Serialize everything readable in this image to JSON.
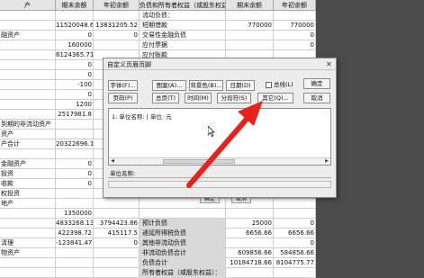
{
  "sheet": {
    "headers": [
      "产",
      "期末余额",
      "年初余额",
      "负债和所有者权益（或股东权益）",
      "期末余额",
      "年初余额"
    ],
    "rows": [
      {
        "label": "",
        "v1": "",
        "v2": "",
        "label2": "流动负债：",
        "v3": "",
        "v4": ""
      },
      {
        "label": "",
        "v1": "11520048.62",
        "v2": "13831205.52",
        "label2": "短期借款",
        "v3": "770000",
        "v4": "770000"
      },
      {
        "label": "融资产",
        "v1": "0",
        "v2": "0",
        "label2": "交易性金融负债",
        "v3": "",
        "v4": "0"
      },
      {
        "label": "",
        "v1": "160000",
        "v2": "",
        "label2": "应付票据",
        "v3": "",
        "v4": "0"
      },
      {
        "label": "",
        "v1": "6124365.71",
        "v2": "",
        "label2": "应付账款",
        "v3": "",
        "v4": ""
      },
      {
        "label": "",
        "v1": "0",
        "v2": "",
        "label2": "",
        "v3": "",
        "v4": ""
      },
      {
        "label": "",
        "v1": "0",
        "v2": "",
        "label2": "",
        "v3": "",
        "v4": ""
      },
      {
        "label": "",
        "v1": "-100",
        "v2": "",
        "label2": "",
        "v3": "",
        "v4": ""
      },
      {
        "label": "",
        "v1": "0",
        "v2": "",
        "label2": "",
        "v3": "",
        "v4": ""
      },
      {
        "label": "",
        "v1": "1200",
        "v2": "",
        "label2": "",
        "v3": "",
        "v4": ""
      },
      {
        "label": "",
        "v1": "2517981.8",
        "v2": "",
        "label2": "",
        "v3": "",
        "v4": ""
      },
      {
        "label": "到期的非流动资产",
        "v1": "",
        "v2": "",
        "label2": "",
        "v3": "",
        "v4": ""
      },
      {
        "label": "资产",
        "v1": "",
        "v2": "",
        "label2": "",
        "v3": "",
        "v4": ""
      },
      {
        "label": "产合计",
        "v1": "20322696.12",
        "v2": "",
        "label2": "",
        "v3": "",
        "v4": ""
      },
      {
        "label": "",
        "v1": "",
        "v2": "",
        "label2": "",
        "v3": "",
        "v4": ""
      },
      {
        "label": "金融资产",
        "v1": "0",
        "v2": "",
        "label2": "",
        "v3": "",
        "v4": ""
      },
      {
        "label": "投资",
        "v1": "0",
        "v2": "",
        "label2": "",
        "v3": "",
        "v4": ""
      },
      {
        "label": "收款",
        "v1": "0",
        "v2": "",
        "label2": "",
        "v3": "",
        "v4": ""
      },
      {
        "label": "权投资",
        "v1": "",
        "v2": "",
        "label2": "",
        "v3": "",
        "v4": ""
      },
      {
        "label": "地产",
        "v1": "",
        "v2": "",
        "label2": "",
        "v3": "",
        "v4": ""
      },
      {
        "label": "",
        "v1": "1350000",
        "v2": "",
        "label2": "",
        "v3": "",
        "v4": ""
      },
      {
        "label": "",
        "v1": "4833268.13",
        "v2": "3794423.86",
        "label2": "预计负债",
        "v3": "25000",
        "v4": "0"
      },
      {
        "label": "",
        "v1": "422398.72",
        "v2": "415117.5",
        "label2": "递延所得税负债",
        "v3": "6656.66",
        "v4": "6656.66"
      },
      {
        "label": "清理",
        "v1": "-123841.47",
        "v2": "0",
        "label2": "其他非流动负债",
        "v3": "",
        "v4": "0"
      },
      {
        "label": "物资产",
        "v1": "",
        "v2": "",
        "label2": "非流动负债合计",
        "v3": "609856.66",
        "v4": "584856.66"
      },
      {
        "label": "",
        "v1": "",
        "v2": "",
        "label2": "负债合计",
        "v3": "10184718.66",
        "v4": "8104775.77"
      },
      {
        "label": "",
        "v1": "",
        "v2": "",
        "label2": "所有者权益（或股东权益）：",
        "v3": "",
        "v4": ""
      }
    ]
  },
  "dialog": {
    "title": "自定义页眉页脚",
    "buttons": {
      "font": "字体(F)...",
      "pattern": "图案(A)...",
      "background": "背景色(B)...",
      "date": "日期(D)",
      "page": "页码(P)",
      "total_pages": "总页(T)",
      "time": "时间(M)",
      "split": "分段符(S)",
      "other": "其它(Q)...",
      "ok": "确定",
      "cancel": "取消"
    },
    "checkbox_label": "总线(L)",
    "header_content": "1: 单位名称: | 单位: 元",
    "footer_label": "单位名称:"
  },
  "parent_buttons": {
    "ok": "确定",
    "cancel": "取消"
  },
  "colors": {
    "arrow": "#e8211c",
    "right_panel": "#4b4b4b",
    "dialog_bg": "#ececec"
  }
}
